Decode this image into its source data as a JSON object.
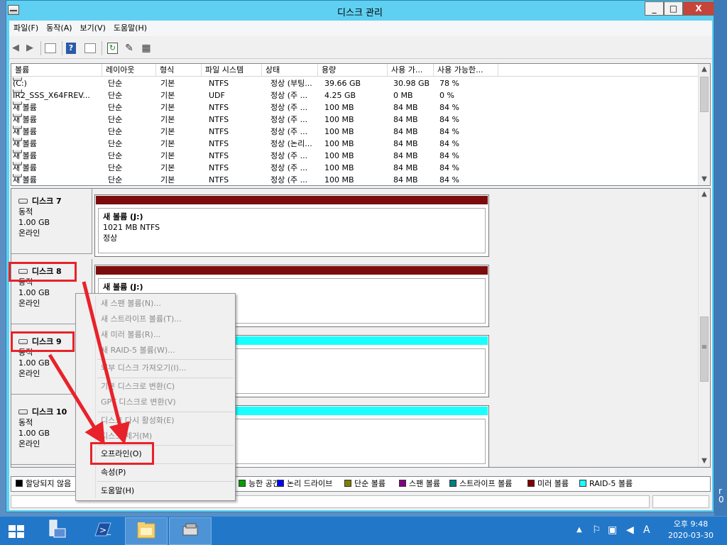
{
  "window": {
    "title": "디스크 관리",
    "minimize": "_",
    "maximize": "□",
    "close": "X"
  },
  "menu": [
    "파일(F)",
    "동작(A)",
    "보기(V)",
    "도움말(H)"
  ],
  "toolbar": [
    "back-icon",
    "forward-icon",
    "console-tree-icon",
    "help-icon",
    "show-panel-icon",
    "refresh-icon",
    "properties-icon",
    "rescan-disks-icon"
  ],
  "volume_table": {
    "columns": [
      "볼륨",
      "레이아웃",
      "형식",
      "파일 시스템",
      "상태",
      "용량",
      "사용 가...",
      "사용 가능한..."
    ],
    "rows": [
      [
        "(C:)",
        "단순",
        "기본",
        "NTFS",
        "정상 (부팅...",
        "39.66 GB",
        "30.98 GB",
        "78 %"
      ],
      [
        "IR2_SSS_X64FREV...",
        "단순",
        "기본",
        "UDF",
        "정상 (주 ...",
        "4.25 GB",
        "0 MB",
        "0 %"
      ],
      [
        "새 볼륨",
        "단순",
        "기본",
        "NTFS",
        "정상 (주 ...",
        "100 MB",
        "84 MB",
        "84 %"
      ],
      [
        "새 볼륨",
        "단순",
        "기본",
        "NTFS",
        "정상 (주 ...",
        "100 MB",
        "84 MB",
        "84 %"
      ],
      [
        "새 볼륨",
        "단순",
        "기본",
        "NTFS",
        "정상 (주 ...",
        "100 MB",
        "84 MB",
        "84 %"
      ],
      [
        "새 볼륨",
        "단순",
        "기본",
        "NTFS",
        "정상 (논리...",
        "100 MB",
        "84 MB",
        "84 %"
      ],
      [
        "새 볼륨",
        "단순",
        "기본",
        "NTFS",
        "정상 (주 ...",
        "100 MB",
        "84 MB",
        "84 %"
      ],
      [
        "새 볼륨",
        "단순",
        "기본",
        "NTFS",
        "정상 (주 ...",
        "100 MB",
        "84 MB",
        "84 %"
      ],
      [
        "새 볼륨",
        "단순",
        "기본",
        "NTFS",
        "정상 (주 ...",
        "100 MB",
        "84 MB",
        "84 %"
      ]
    ]
  },
  "disks": [
    {
      "name": "디스크 7",
      "type": "동적",
      "size": "1.00 GB",
      "status": "온라인",
      "partition_title": "새 볼륨  (J:)",
      "partition_info": "1021 MB NTFS",
      "partition_status": "정상",
      "stripe_color": "#7c0c0c"
    },
    {
      "name": "디스크 8",
      "type": "동적",
      "size": "1.00 GB",
      "status": "온라인",
      "partition_title": "새 볼륨  (J:)",
      "partition_info": "1021 MB NTFS",
      "partition_status": "",
      "stripe_color": "#7c0c0c"
    },
    {
      "name": "디스크 9",
      "type": "동적",
      "size": "1.00 GB",
      "status": "온라인",
      "partition_title": "",
      "partition_info": "",
      "partition_status": "",
      "stripe_color": "#19ffff"
    },
    {
      "name": "디스크 10",
      "type": "동적",
      "size": "1.00 GB",
      "status": "온라인",
      "partition_title": "",
      "partition_info": "",
      "partition_status": "",
      "stripe_color": "#19ffff"
    }
  ],
  "legend": [
    {
      "label": "할당되지 않음",
      "color": "#000000"
    },
    {
      "label": "능한 공간",
      "color": "#00a000"
    },
    {
      "label": "논리 드라이브",
      "color": "#0000ff"
    },
    {
      "label": "단순 볼륨",
      "color": "#808000"
    },
    {
      "label": "스팬 볼륨",
      "color": "#800080"
    },
    {
      "label": "스트라이프 볼륨",
      "color": "#008080"
    },
    {
      "label": "미러 볼륨",
      "color": "#800000"
    },
    {
      "label": "RAID-5 볼륨",
      "color": "#19ffff"
    }
  ],
  "context_menu": {
    "items": [
      {
        "label": "새 스팬 볼륨(N)...",
        "enabled": false
      },
      {
        "label": "새 스트라이프 볼륨(T)...",
        "enabled": false
      },
      {
        "label": "새 미러 볼륨(R)...",
        "enabled": false
      },
      {
        "label": "새 RAID-5 볼륨(W)...",
        "enabled": false
      },
      {
        "label": "외부 디스크 가져오기(I)...",
        "enabled": false
      },
      {
        "label": "기본 디스크로 변환(C)",
        "enabled": false
      },
      {
        "label": "GPT 디스크로 변환(V)",
        "enabled": false
      },
      {
        "label": "디스크 다시 활성화(E)",
        "enabled": false
      },
      {
        "label": "디스크 제거(M)",
        "enabled": false
      },
      {
        "label": "오프라인(O)",
        "enabled": true
      },
      {
        "label": "속성(P)",
        "enabled": true
      },
      {
        "label": "도움말(H)",
        "enabled": true
      }
    ]
  },
  "annotation_color": "#e8222a",
  "taskbar": {
    "apps": [
      "server-manager-icon",
      "powershell-icon",
      "file-explorer-icon",
      "disk-management-icon"
    ],
    "clock_time": "오후 9:48",
    "clock_date": "2020-03-30",
    "ime": "A",
    "desktop_clip_text": "r\n0"
  }
}
